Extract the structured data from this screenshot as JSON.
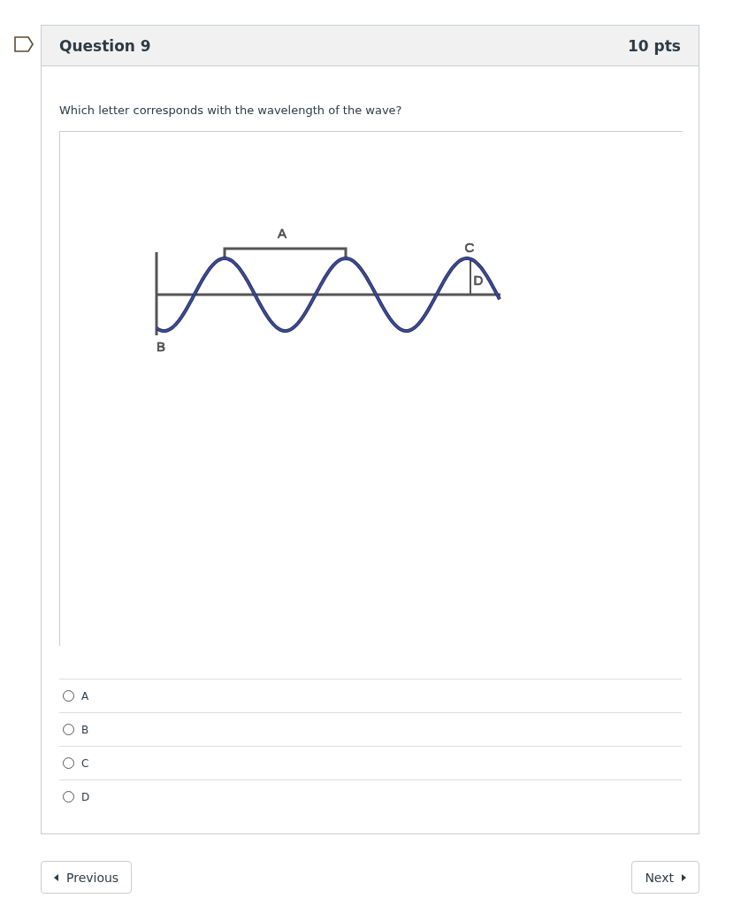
{
  "question": {
    "title": "Question 9",
    "points": "10 pts",
    "prompt": "Which letter corresponds with the wavelength of the wave?"
  },
  "figure": {
    "labels": [
      "A",
      "B",
      "C",
      "D"
    ]
  },
  "answers": [
    {
      "label": "A",
      "selected": false
    },
    {
      "label": "B",
      "selected": false
    },
    {
      "label": "C",
      "selected": false
    },
    {
      "label": "D",
      "selected": false
    }
  ],
  "nav": {
    "previous": "Previous",
    "next": "Next"
  }
}
